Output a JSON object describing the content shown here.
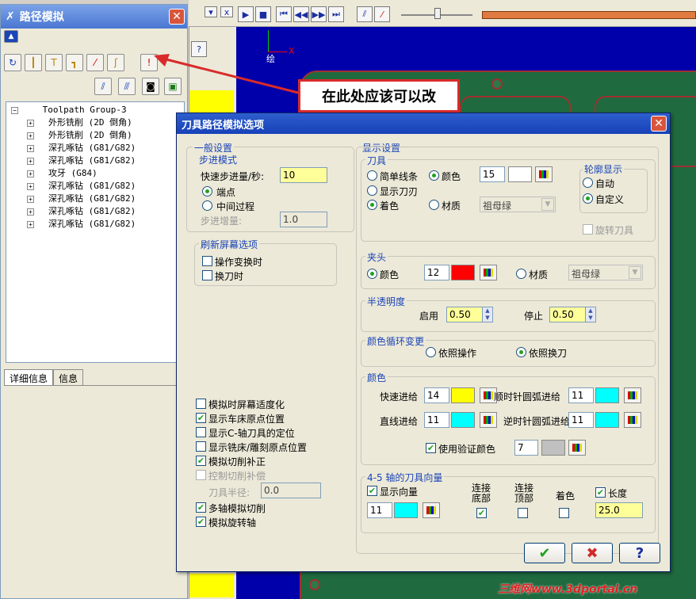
{
  "panel": {
    "title": "路径模拟",
    "tree_root": "Toolpath Group-3",
    "tree_items": [
      "外形铣削 (2D 倒角)",
      "外形铣削 (2D 倒角)",
      "深孔啄钻 (G81/G82)",
      "深孔啄钻 (G81/G82)",
      "攻牙 (G84)",
      "深孔啄钻 (G81/G82)",
      "深孔啄钻 (G81/G82)",
      "深孔啄钻 (G81/G82)",
      "深孔啄钻 (G81/G82)"
    ],
    "tabs": [
      "详细信息",
      "信息"
    ]
  },
  "cad": {
    "axis_x": "X",
    "axis_label": "绘"
  },
  "annotation": "在此处应该可以改",
  "watermark": "三维网www.3dportal.cn",
  "dialog": {
    "title": "刀具路径模拟选项",
    "general": {
      "title": "一般设置",
      "step_mode": "步进模式",
      "rapid_label": "快速步进量/秒:",
      "rapid_value": "10",
      "endpoint": "端点",
      "midprocess": "中间过程",
      "step_inc_label": "步进增量:",
      "step_inc_value": "1.0"
    },
    "refresh": {
      "title": "刷新屏幕选项",
      "op_change": "操作变换时",
      "tool_change": "换刀时"
    },
    "options": {
      "adapt": "模拟时屏幕适度化",
      "lathe_origin": "显示车床原点位置",
      "c_axis": "显示C-轴刀具的定位",
      "mill_origin": "显示铣床/雕刻原点位置",
      "cut_comp": "模拟切削补正",
      "ctrl_comp": "控制切削补偿",
      "tool_radius_label": "刀具半径:",
      "tool_radius_value": "0.0",
      "multi_axis": "多轴模拟切削",
      "rotary": "模拟旋转轴"
    },
    "display": {
      "title": "显示设置",
      "tool_title": "刀具",
      "simple_line": "简单线条",
      "color": "颜色",
      "color_value": "15",
      "show_tool": "显示刀刃",
      "shade": "着色",
      "material": "材质",
      "material_value": "祖母绿",
      "outline_title": "轮廓显示",
      "auto": "自动",
      "custom": "自定义",
      "rotate_tool": "旋转刀具"
    },
    "holder": {
      "title": "夹头",
      "color": "颜色",
      "color_value": "12",
      "material": "材质",
      "material_value": "祖母绿"
    },
    "transparency": {
      "title": "半透明度",
      "start": "启用",
      "start_value": "0.50",
      "stop": "停止",
      "stop_value": "0.50"
    },
    "cycle": {
      "title": "颜色循环变更",
      "by_op": "依照操作",
      "by_tool": "依照换刀"
    },
    "colors": {
      "title": "颜色",
      "rapid": "快速进给",
      "rapid_value": "14",
      "cw_arc": "顺时针圆弧进给",
      "cw_arc_value": "11",
      "linear": "直线进给",
      "linear_value": "11",
      "ccw_arc": "逆时针圆弧进给",
      "ccw_arc_value": "11",
      "verify": "使用验证颜色",
      "verify_value": "7"
    },
    "vectors": {
      "title": "4-5 轴的刀具向量",
      "show": "显示向量",
      "show_value": "11",
      "bottom": "连接底部",
      "top": "连接顶部",
      "shade": "着色",
      "length": "长度",
      "length_value": "25.0"
    },
    "buttons": {
      "ok": "✔",
      "cancel": "✖",
      "help": "?"
    }
  },
  "colors": {
    "yellow": "#ffff00",
    "cyan": "#00ffff",
    "red": "#ff0000",
    "gray": "#c0c0c0",
    "title_blue": "#1741b8"
  }
}
